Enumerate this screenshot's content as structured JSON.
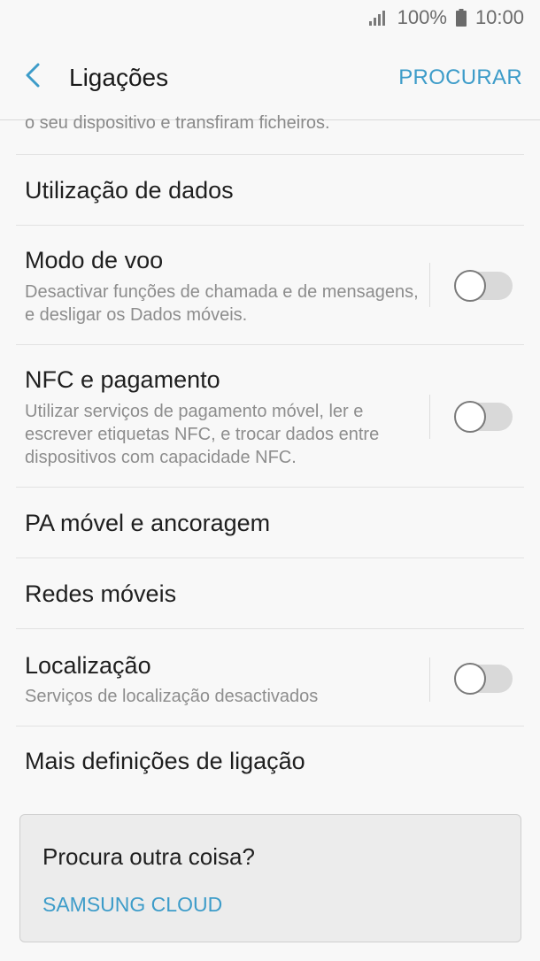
{
  "status_bar": {
    "battery_percent": "100%",
    "time": "10:00"
  },
  "header": {
    "title": "Ligações",
    "action": "PROCURAR"
  },
  "list": {
    "partial_text": "o seu dispositivo e transfiram ficheiros.",
    "items": [
      {
        "title": "Utilização de dados"
      },
      {
        "title": "Modo de voo",
        "subtitle": "Desactivar funções de chamada e de mensagens, e desligar os Dados móveis.",
        "toggle_on": false
      },
      {
        "title": "NFC e pagamento",
        "subtitle": "Utilizar serviços de pagamento móvel, ler e escrever etiquetas NFC, e trocar dados entre dispositivos com capacidade NFC.",
        "toggle_on": false
      },
      {
        "title": "PA móvel e ancoragem"
      },
      {
        "title": "Redes móveis"
      },
      {
        "title": "Localização",
        "subtitle": "Serviços de localização desactivados",
        "toggle_on": false
      },
      {
        "title": "Mais definições de ligação"
      }
    ]
  },
  "card": {
    "title": "Procura outra coisa?",
    "link": "SAMSUNG CLOUD"
  },
  "colors": {
    "accent": "#3d9cc9",
    "background": "#f8f8f8"
  }
}
